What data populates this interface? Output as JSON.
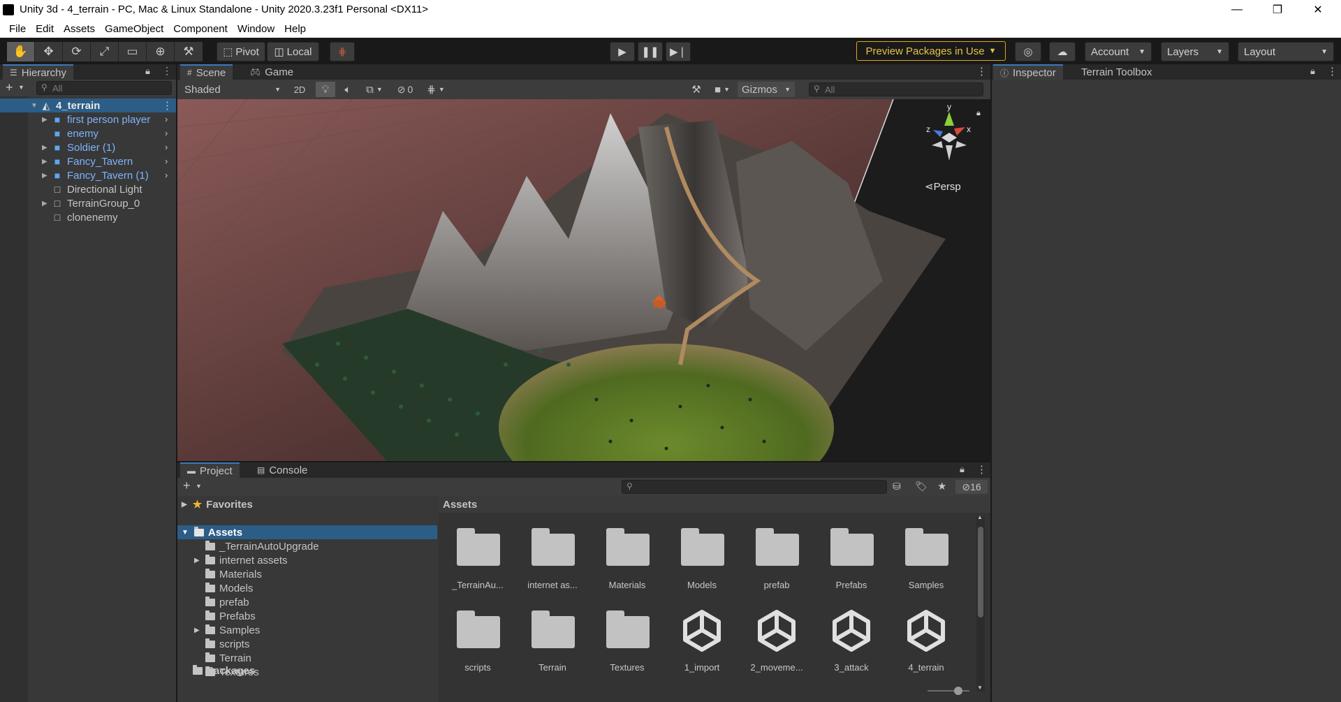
{
  "window": {
    "title": "Unity 3d - 4_terrain - PC, Mac & Linux Standalone - Unity 2020.3.23f1 Personal <DX11>",
    "controls": [
      "—",
      "❐",
      "✕"
    ]
  },
  "menu": [
    "File",
    "Edit",
    "Assets",
    "GameObject",
    "Component",
    "Window",
    "Help"
  ],
  "toolbar": {
    "pivot": "Pivot",
    "local": "Local",
    "preview_packages": "Preview Packages in Use",
    "account": "Account",
    "layers": "Layers",
    "layout": "Layout"
  },
  "hierarchy": {
    "tab": "Hierarchy",
    "search_placeholder": "All",
    "scene_name": "4_terrain",
    "items": [
      {
        "label": "first person player",
        "prefab": true,
        "expandable": true
      },
      {
        "label": "enemy",
        "prefab": true,
        "expandable": false
      },
      {
        "label": "Soldier (1)",
        "prefab": true,
        "expandable": true
      },
      {
        "label": "Fancy_Tavern",
        "prefab": true,
        "expandable": true
      },
      {
        "label": "Fancy_Tavern (1)",
        "prefab": true,
        "expandable": true
      },
      {
        "label": "Directional Light",
        "prefab": false,
        "expandable": false
      },
      {
        "label": "TerrainGroup_0",
        "prefab": false,
        "expandable": true
      },
      {
        "label": "clonenemy",
        "prefab": false,
        "expandable": false
      }
    ]
  },
  "scene": {
    "tabs": [
      "Scene",
      "Game"
    ],
    "shading": "Shaded",
    "mode_2d": "2D",
    "hidden_count": "0",
    "gizmos": "Gizmos",
    "search_placeholder": "All",
    "persp": "Persp",
    "gizmo_axes": {
      "y": "y",
      "x": "x",
      "z": "z"
    }
  },
  "inspector": {
    "tabs": [
      "Inspector",
      "Terrain Toolbox"
    ]
  },
  "project": {
    "tabs": [
      "Project",
      "Console"
    ],
    "hidden_count": "16",
    "favorites": "Favorites",
    "assets_root": "Assets",
    "tree": [
      {
        "label": "_TerrainAutoUpgrade",
        "expandable": false
      },
      {
        "label": "internet assets",
        "expandable": true
      },
      {
        "label": "Materials",
        "expandable": false
      },
      {
        "label": "Models",
        "expandable": false
      },
      {
        "label": "prefab",
        "expandable": false
      },
      {
        "label": "Prefabs",
        "expandable": false
      },
      {
        "label": "Samples",
        "expandable": true
      },
      {
        "label": "scripts",
        "expandable": false
      },
      {
        "label": "Terrain",
        "expandable": false
      },
      {
        "label": "Textures",
        "expandable": false
      }
    ],
    "packages": "Packages",
    "grid_title": "Assets",
    "grid": [
      {
        "label": "_TerrainAu...",
        "kind": "folder"
      },
      {
        "label": "internet as...",
        "kind": "folder"
      },
      {
        "label": "Materials",
        "kind": "folder"
      },
      {
        "label": "Models",
        "kind": "folder"
      },
      {
        "label": "prefab",
        "kind": "folder"
      },
      {
        "label": "Prefabs",
        "kind": "folder"
      },
      {
        "label": "Samples",
        "kind": "folder"
      },
      {
        "label": "scripts",
        "kind": "folder"
      },
      {
        "label": "Terrain",
        "kind": "folder"
      },
      {
        "label": "Textures",
        "kind": "folder"
      },
      {
        "label": "1_import",
        "kind": "scene"
      },
      {
        "label": "2_moveme...",
        "kind": "scene"
      },
      {
        "label": "3_attack",
        "kind": "scene"
      },
      {
        "label": "4_terrain",
        "kind": "scene"
      }
    ]
  },
  "colors": {
    "accent": "#3a79bb",
    "prefab_text": "#7cb4ff",
    "preview_border": "#e6a417"
  }
}
